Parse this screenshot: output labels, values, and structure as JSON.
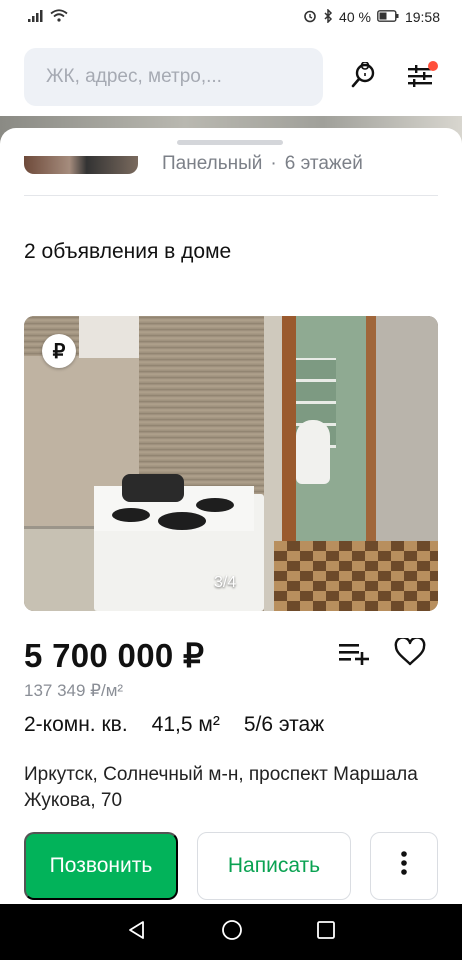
{
  "status_bar": {
    "battery": "40 %",
    "time": "19:58"
  },
  "search": {
    "placeholder": "ЖК, адрес, метро,..."
  },
  "house": {
    "type": "Панельный",
    "separator": "·",
    "floors": "6 этажей"
  },
  "section": {
    "title": "2 объявления в доме"
  },
  "listing": {
    "photo_counter": "3/4",
    "rub_badge": "₽",
    "price": "5 700 000 ₽",
    "price_per_m2": "137 349 ₽/м²",
    "rooms": "2-комн. кв.",
    "area": "41,5 м²",
    "floor": "5/6 этаж",
    "address": "Иркутск, Солнечный м-н, проспект Маршала Жукова, 70"
  },
  "actions": {
    "call_label": "Позвонить",
    "write_label": "Написать"
  },
  "colors": {
    "accent_green": "#02b35a",
    "notification_dot": "#ff4f3b"
  }
}
